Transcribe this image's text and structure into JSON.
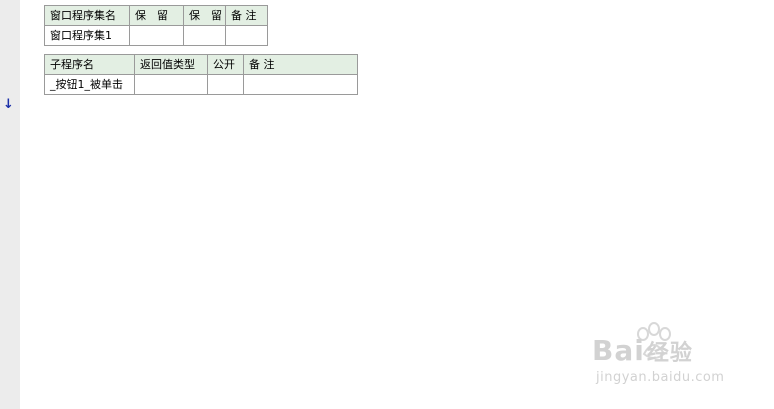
{
  "window_table": {
    "headers": [
      "窗口程序集名",
      "保　留",
      "保　留",
      "备 注"
    ],
    "row": [
      "窗口程序集1",
      "",
      "",
      ""
    ]
  },
  "sub_table": {
    "headers": [
      "子程序名",
      "返回值类型",
      "公开",
      "备 注"
    ],
    "row": [
      "_按钮1_被单击",
      "",
      "",
      ""
    ]
  },
  "gutter": {
    "marker_icon": "down-arrow-icon",
    "marker_glyph": "↓"
  },
  "watermark": {
    "logo_text": "Bai",
    "logo_cn": "经验",
    "url": "jingyan.baidu.com"
  }
}
